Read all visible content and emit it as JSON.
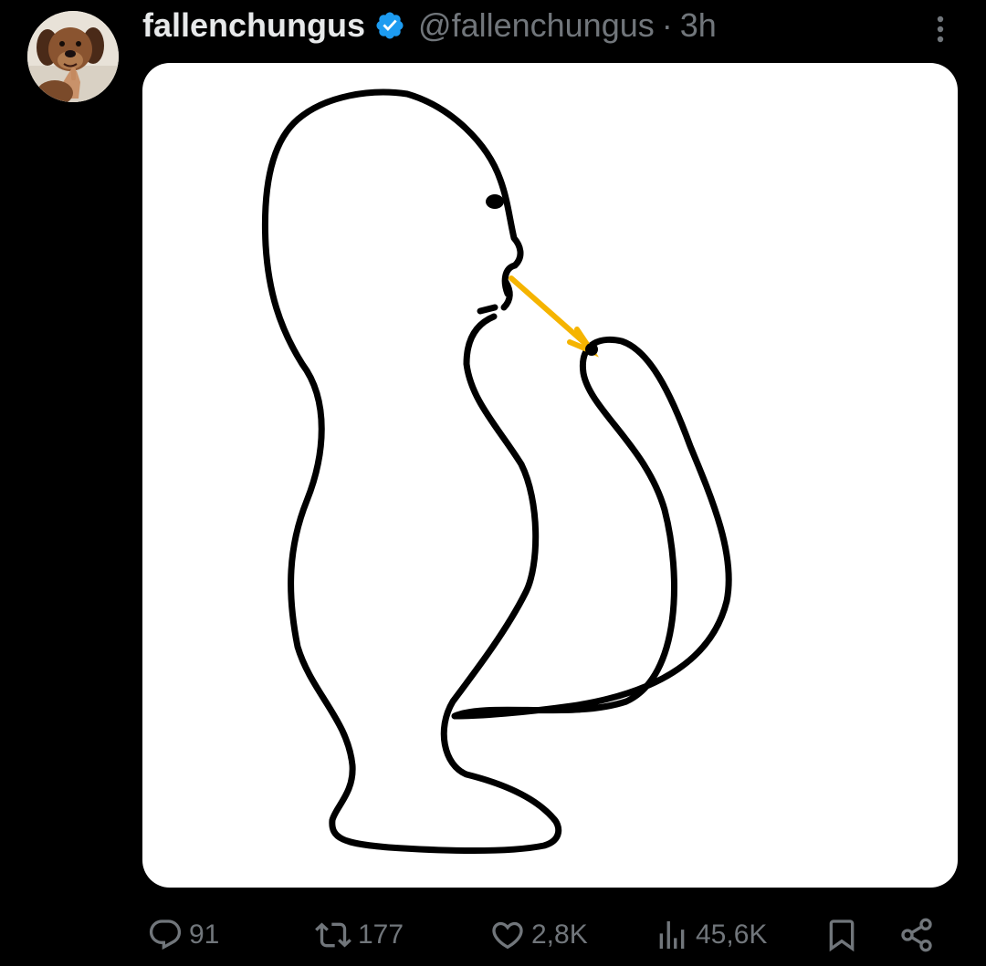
{
  "post": {
    "display_name": "fallenchungus",
    "handle": "@fallenchungus",
    "separator": "·",
    "time": "3h",
    "verified": true,
    "badge_color": "#1d9bf0"
  },
  "avatar": {
    "icon": "dog-photo-avatar"
  },
  "media": {
    "description_icon": "hand-drawn-figure-image",
    "accent_color": "#f5b400"
  },
  "actions": {
    "replies": "91",
    "reposts": "177",
    "likes": "2,8K",
    "views": "45,6K"
  },
  "colors": {
    "background": "#000000",
    "text_primary": "#e7e9ea",
    "text_secondary": "#71767b"
  }
}
